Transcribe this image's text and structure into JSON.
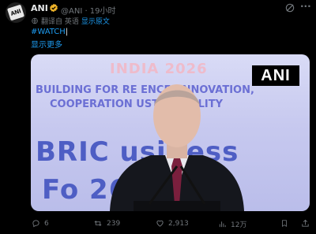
{
  "tweet": {
    "author_name": "ANI",
    "handle_time": "@ANI · 19小时",
    "translate_label": "翻译自 英语",
    "translate_link": "显示原文",
    "hashtag": "#WATCH",
    "cursor": "|",
    "show_more": "显示更多",
    "more_label": "···"
  },
  "media": {
    "banner_title": "INDIA 2026",
    "banner_line1": "BUILDING FOR RE   ENCE, INNOVATION,",
    "banner_line2": "COOPERATION        USTAINABILITY",
    "big_line1": "BRIC    usiness",
    "big_line2": "Fo          26",
    "logo_text": "ANI"
  },
  "actions": {
    "replies": "6",
    "retweets": "239",
    "likes": "2,913",
    "views": "12万"
  },
  "colors": {
    "background": "#000000",
    "text": "#e7e9ea",
    "muted": "#71767b",
    "link": "#1d9bf0",
    "verified": "#f0b429"
  }
}
